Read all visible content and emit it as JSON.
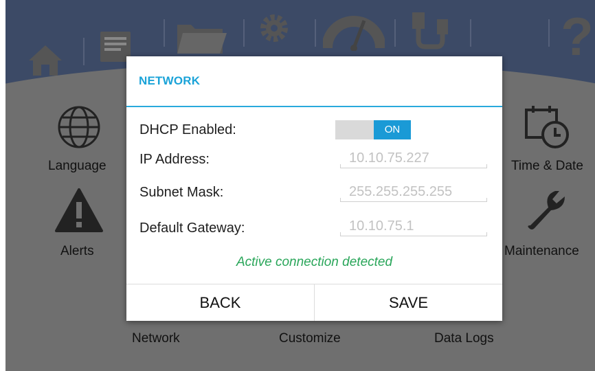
{
  "topbar": {
    "icons": [
      "home-icon",
      "notes-icon",
      "folder-icon",
      "gear-icon",
      "gauge-icon",
      "usb-icon",
      "help-icon"
    ]
  },
  "tiles": {
    "language": {
      "label": "Language",
      "icon": "globe-icon"
    },
    "time_date": {
      "label": "Time & Date",
      "icon": "calendar-clock-icon"
    },
    "alerts": {
      "label": "Alerts",
      "icon": "warning-icon"
    },
    "maintenance": {
      "label": "Maintenance",
      "icon": "wrench-icon"
    },
    "network": {
      "label": "Network"
    },
    "customize": {
      "label": "Customize"
    },
    "data_logs": {
      "label": "Data Logs"
    }
  },
  "dialog": {
    "title": "NETWORK",
    "dhcp_label": "DHCP Enabled:",
    "dhcp_state": "ON",
    "ip_label": "IP Address:",
    "ip_value": "10.10.75.227",
    "subnet_label": "Subnet Mask:",
    "subnet_value": "255.255.255.255",
    "gateway_label": "Default Gateway:",
    "gateway_value": "10.10.75.1",
    "status": "Active connection detected",
    "back_label": "BACK",
    "save_label": "SAVE"
  },
  "colors": {
    "accent": "#1a9ad6",
    "status_green": "#2aa65a",
    "topbar": "#3c4a66",
    "dim_background": "#6f6f6f"
  }
}
